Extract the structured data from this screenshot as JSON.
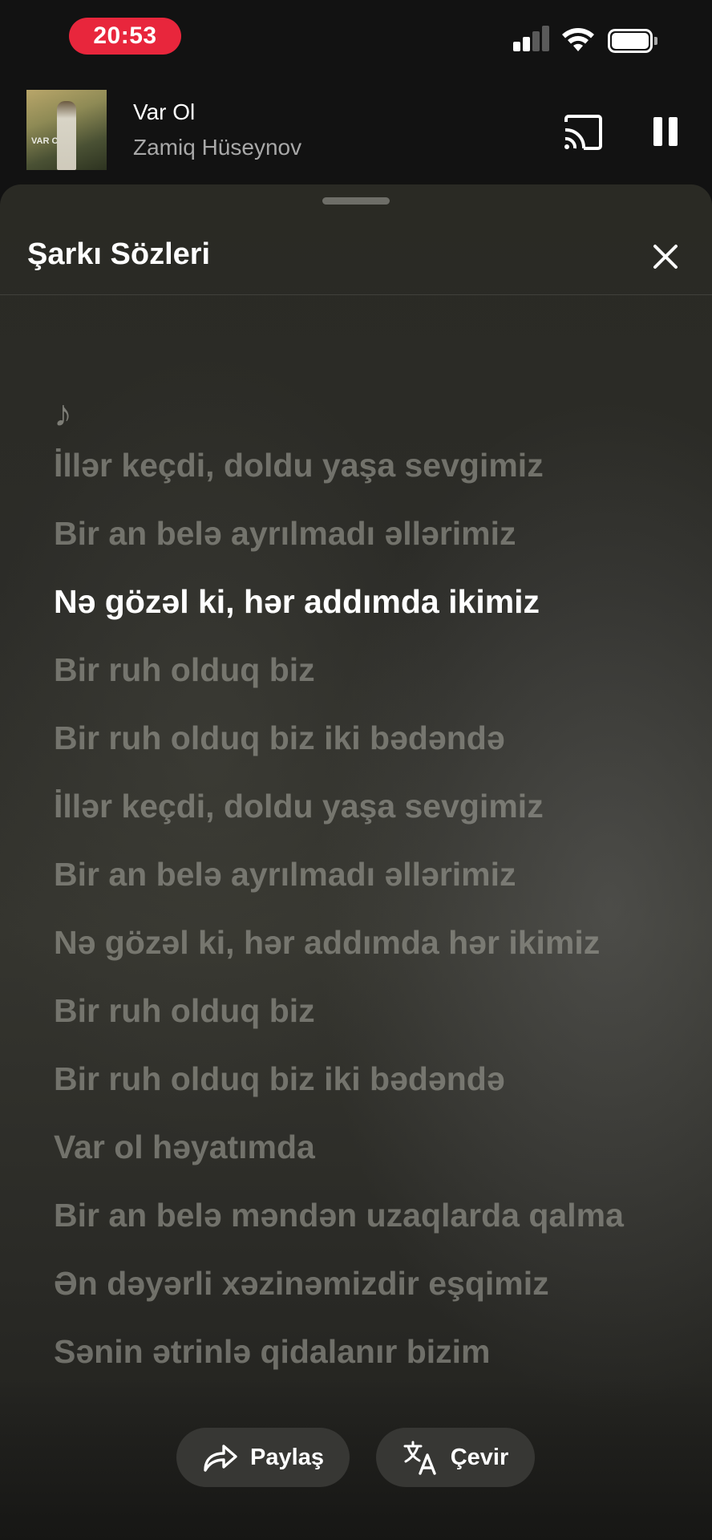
{
  "status_bar": {
    "time": "20:53"
  },
  "mini_player": {
    "album_art_text": "VAR OL",
    "title": "Var Ol",
    "artist": "Zamiq Hüseynov"
  },
  "lyrics_sheet": {
    "title": "Şarkı Sözleri",
    "intro_symbol": "♪",
    "lines": [
      {
        "text": "İllər keçdi, doldu yaşa sevgimiz",
        "active": false
      },
      {
        "text": "Bir an belə ayrılmadı əllərimiz",
        "active": false
      },
      {
        "text": "Nə gözəl ki, hər addımda ikimiz",
        "active": true
      },
      {
        "text": "Bir ruh olduq biz",
        "active": false
      },
      {
        "text": "Bir ruh olduq biz iki bədəndə",
        "active": false
      },
      {
        "text": "İllər keçdi, doldu yaşa sevgimiz",
        "active": false
      },
      {
        "text": "Bir an belə ayrılmadı əllərimiz",
        "active": false
      },
      {
        "text": "Nə gözəl ki, hər addımda hər ikimiz",
        "active": false
      },
      {
        "text": "Bir ruh olduq biz",
        "active": false
      },
      {
        "text": "Bir ruh olduq biz iki bədəndə",
        "active": false
      },
      {
        "text": "Var ol həyatımda",
        "active": false
      },
      {
        "text": "Bir an belə məndən uzaqlarda qalma",
        "active": false
      },
      {
        "text": "Ən dəyərli xəzinəmizdir eşqimiz",
        "active": false
      },
      {
        "text": "Sənin ətrinlə qidalanır bizim",
        "active": false
      }
    ],
    "share_label": "Paylaş",
    "translate_label": "Çevir"
  }
}
